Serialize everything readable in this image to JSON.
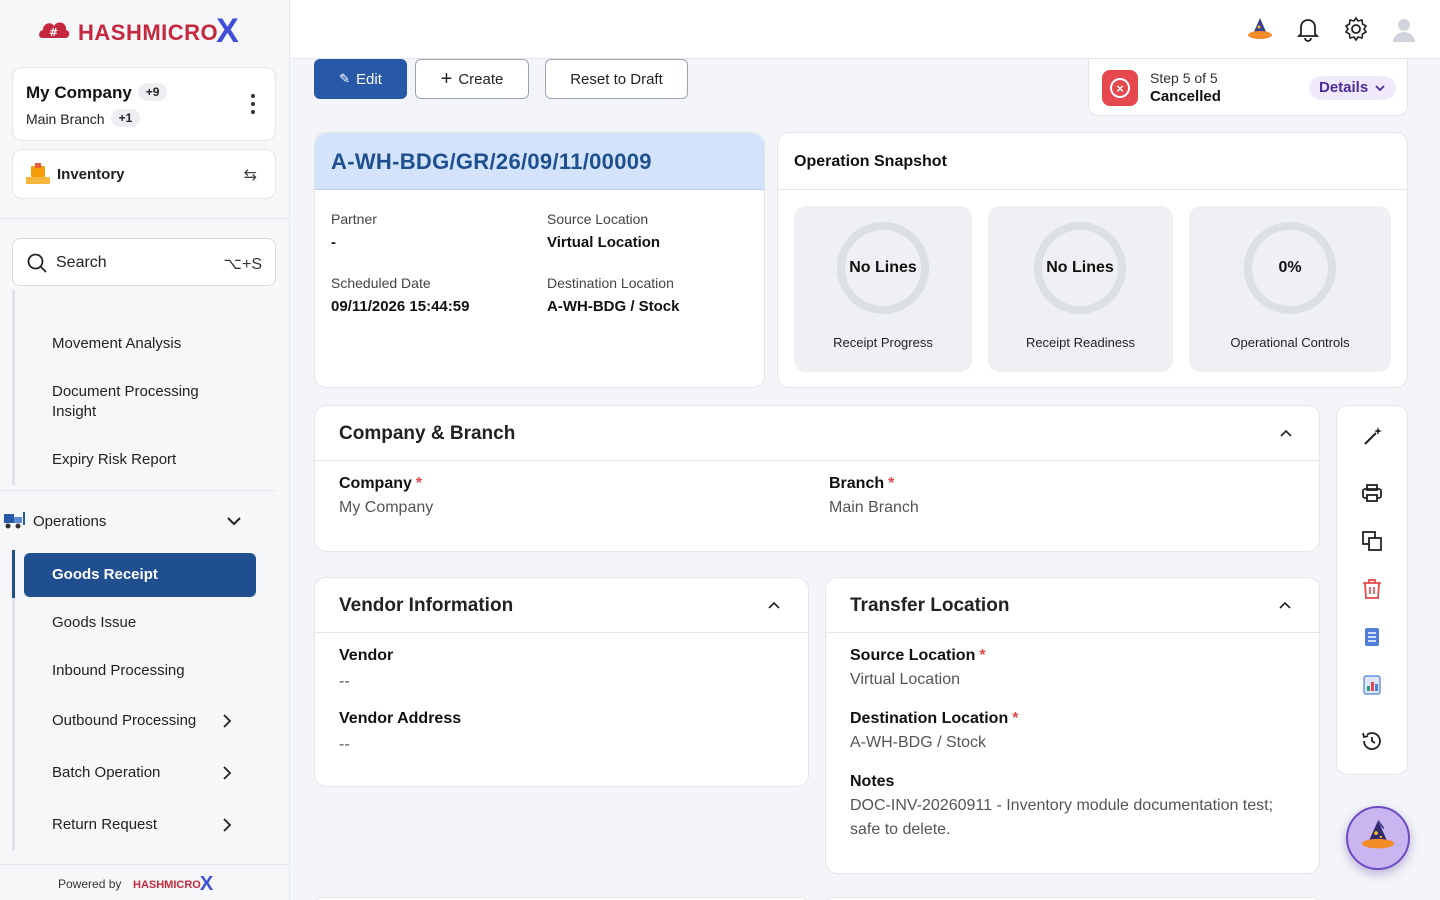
{
  "brand": {
    "logo_text": "HASHMICRO",
    "logo_x": "X"
  },
  "sidebar": {
    "company": {
      "name": "My Company",
      "company_badge": "+9",
      "branch": "Main Branch",
      "branch_badge": "+1"
    },
    "module": {
      "label": "Inventory",
      "icon": "inventory-icon"
    },
    "search": {
      "label": "Search",
      "shortcut": "⌥+S"
    },
    "nav": {
      "reporting_items": [
        "Movement Analysis",
        "Document Processing Insight",
        "Expiry Risk Report"
      ],
      "operations": {
        "label": "Operations",
        "items": [
          {
            "label": "Goods Receipt",
            "active": true
          },
          {
            "label": "Goods Issue"
          },
          {
            "label": "Inbound Processing"
          },
          {
            "label": "Outbound Processing",
            "submenu": true
          },
          {
            "label": "Batch Operation",
            "submenu": true
          },
          {
            "label": "Return Request",
            "submenu": true
          }
        ]
      }
    },
    "powered_by": "Powered by"
  },
  "topbar": {
    "icons": [
      "wizard-hat-icon",
      "bell-icon",
      "gear-icon",
      "user-avatar-icon"
    ]
  },
  "actions": {
    "edit": "Edit",
    "create": "Create",
    "reset": "Reset to Draft"
  },
  "status": {
    "step": "Step 5 of 5",
    "value": "Cancelled",
    "details": "Details"
  },
  "record": {
    "reference": "A-WH-BDG/GR/26/09/11/00009",
    "partner_label": "Partner",
    "partner_value": "-",
    "source_label": "Source Location",
    "source_value": "Virtual Location",
    "scheduled_label": "Scheduled Date",
    "scheduled_value": "09/11/2026 15:44:59",
    "destination_label": "Destination Location",
    "destination_value": "A-WH-BDG / Stock"
  },
  "snapshot": {
    "title": "Operation Snapshot",
    "tiles": [
      {
        "value": "No Lines",
        "label": "Receipt Progress"
      },
      {
        "value": "No Lines",
        "label": "Receipt Readiness"
      },
      {
        "value": "0%",
        "label": "Operational Controls"
      }
    ]
  },
  "company_branch": {
    "title": "Company & Branch",
    "company_label": "Company",
    "company_value": "My Company",
    "branch_label": "Branch",
    "branch_value": "Main Branch"
  },
  "vendor": {
    "title": "Vendor Information",
    "vendor_label": "Vendor",
    "vendor_value": "--",
    "address_label": "Vendor Address",
    "address_value": "--"
  },
  "transfer": {
    "title": "Transfer Location",
    "source_label": "Source Location",
    "source_value": "Virtual Location",
    "destination_label": "Destination Location",
    "destination_value": "A-WH-BDG / Stock",
    "notes_label": "Notes",
    "notes_value": "DOC-INV-20260911 - Inventory module documentation test; safe to delete."
  },
  "toolbar": {
    "icons": [
      "magic-wand-icon",
      "print-icon",
      "duplicate-icon",
      "delete-icon",
      "list-report-icon",
      "chart-report-icon",
      "history-icon"
    ]
  },
  "colors": {
    "primary": "#2759a8",
    "active_nav": "#1f4f8f",
    "danger": "#e5484d",
    "accent_purple": "#4c2c99"
  }
}
